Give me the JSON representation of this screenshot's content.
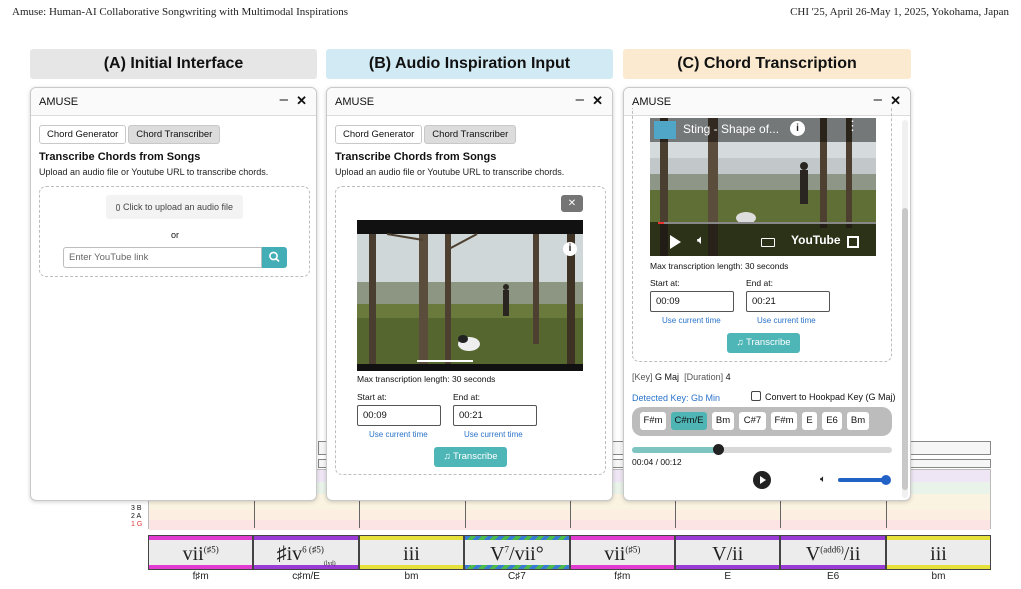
{
  "page_header": {
    "left": "Amuse: Human-AI Collaborative Songwriting with Multimodal Inspirations",
    "right": "CHI '25, April 26-May 1, 2025, Yokohama, Japan"
  },
  "banners": [
    {
      "label": "(A) Initial Interface",
      "color": "#e6e6e6"
    },
    {
      "label": "(B) Audio Inspiration Input",
      "color": "#d2eaf3"
    },
    {
      "label": "(C) Chord Transcription",
      "color": "#fbead0"
    }
  ],
  "window": {
    "title": "AMUSE",
    "minimize_label": "–",
    "close_label": "✕",
    "tabs": [
      "Chord Generator",
      "Chord Transcriber"
    ],
    "heading": "Transcribe Chords from Songs",
    "description": "Upload an audio file or Youtube URL to transcribe chords."
  },
  "panel_a": {
    "upload_label": "Click to upload an audio file",
    "or_label": "or",
    "youtube_placeholder": "Enter YouTube link"
  },
  "panel_b": {
    "dismiss_label": "✕",
    "video_info_icon": "i"
  },
  "transcription_form": {
    "max_length": "Max transcription length: 30 seconds",
    "start_label": "Start at:",
    "end_label": "End at:",
    "start_value": "00:09",
    "end_value": "00:21",
    "use_current": "Use current time",
    "transcribe_label": "Transcribe"
  },
  "panel_c": {
    "video_title": "Sting - Shape of...",
    "youtube_label": "YouTube",
    "key_prefix": "[Key]",
    "key_value": "G Maj",
    "duration_prefix": "[Duration]",
    "duration_value": "4",
    "detected_key": "Detected Key: Gb Min",
    "convert_label": "Convert to Hookpad Key (G Maj)",
    "convert_checked": false,
    "chords": [
      "F#m",
      "C#m/E",
      "Bm",
      "C#7",
      "F#m",
      "E",
      "E6",
      "Bm"
    ],
    "selected_chord_index": 1,
    "time_display": "00:04 / 00:12",
    "progress": 0.33,
    "volume": 0.95
  },
  "piano_roll": {
    "lane_labels": [
      "3 B",
      "2 A",
      "1 G"
    ]
  },
  "roman_numerals": [
    {
      "numeral": "vii",
      "sup": "(♯5)",
      "prefix": "",
      "sub": "",
      "slash": "",
      "chord": "f♯m",
      "color": "#e23bd0"
    },
    {
      "numeral": "iv",
      "sup": "6 (♯5)",
      "prefix": "♯",
      "sub": "(lyd)",
      "slash": "",
      "chord": "c♯m/E",
      "color": "#9a3bd6"
    },
    {
      "numeral": "iii",
      "sup": "",
      "prefix": "",
      "sub": "",
      "slash": "",
      "chord": "bm",
      "color": "#e5e03a"
    },
    {
      "numeral": "V",
      "sup": "7",
      "prefix": "",
      "sub": "",
      "slash": "vii°",
      "chord": "C♯7",
      "color": "#3a7bd5"
    },
    {
      "numeral": "vii",
      "sup": "(♯5)",
      "prefix": "",
      "sub": "",
      "slash": "",
      "chord": "f♯m",
      "color": "#e23bd0"
    },
    {
      "numeral": "V",
      "sup": "",
      "prefix": "",
      "sub": "",
      "slash": "ii",
      "chord": "E",
      "color": "#9a3bd6"
    },
    {
      "numeral": "V",
      "sup": "(add6)",
      "prefix": "",
      "sub": "",
      "slash": "ii",
      "chord": "E6",
      "color": "#9a3bd6"
    },
    {
      "numeral": "iii",
      "sup": "",
      "prefix": "",
      "sub": "",
      "slash": "",
      "chord": "bm",
      "color": "#e5e03a"
    }
  ]
}
